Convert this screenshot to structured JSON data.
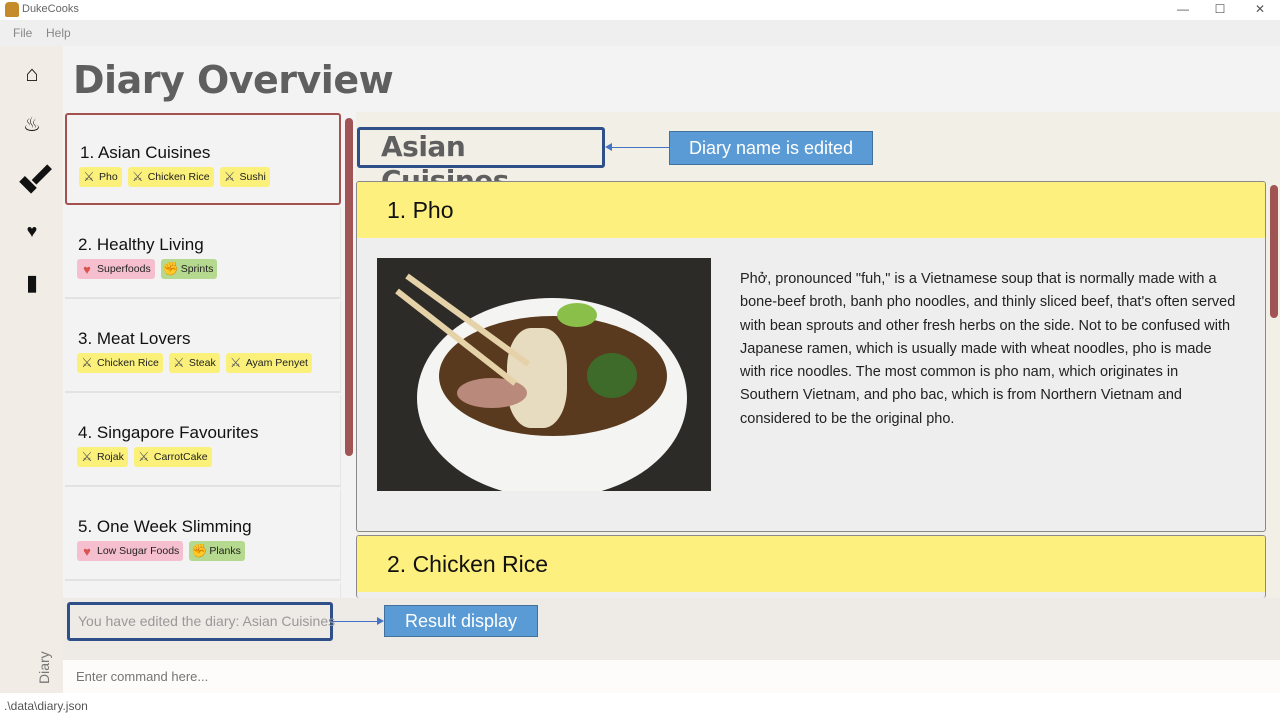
{
  "window": {
    "title": "DukeCooks",
    "minimize_icon": "minimize-icon",
    "maximize_icon": "maximize-icon",
    "close_icon": "close-icon"
  },
  "menu": {
    "file": "File",
    "help": "Help"
  },
  "rail": {
    "items": [
      "home-icon",
      "chef-hat-icon",
      "dumbbell-icon",
      "heartbeat-icon",
      "diary-book-icon"
    ],
    "label": "Diary"
  },
  "page_title": "Diary Overview",
  "diaries": [
    {
      "name": "1.  Asian Cuisines",
      "tags": [
        {
          "type": "food",
          "label": "Pho"
        },
        {
          "type": "food",
          "label": "Chicken Rice"
        },
        {
          "type": "food",
          "label": "Sushi"
        }
      ]
    },
    {
      "name": "2.  Healthy Living",
      "tags": [
        {
          "type": "health",
          "label": "Superfoods"
        },
        {
          "type": "ex",
          "label": "Sprints"
        }
      ]
    },
    {
      "name": "3.  Meat Lovers",
      "tags": [
        {
          "type": "food",
          "label": "Chicken Rice"
        },
        {
          "type": "food",
          "label": "Steak"
        },
        {
          "type": "food",
          "label": "Ayam Penyet"
        }
      ]
    },
    {
      "name": "4.  Singapore Favourites",
      "tags": [
        {
          "type": "food",
          "label": "Rojak"
        },
        {
          "type": "food",
          "label": "CarrotCake"
        }
      ]
    },
    {
      "name": "5.  One Week Slimming",
      "tags": [
        {
          "type": "health",
          "label": "Low Sugar Foods"
        },
        {
          "type": "ex",
          "label": "Planks"
        }
      ]
    }
  ],
  "detail": {
    "diary_name": "Asian Cuisines",
    "pages": [
      {
        "title": "1. Pho",
        "description": "Phở, pronounced \"fuh,\" is a Vietnamese soup that is normally made with a bone-beef broth, banh pho noodles, and thinly sliced beef, that's often served with bean sprouts and other fresh herbs on the side. Not to be confused with Japanese ramen, which is usually made with wheat noodles, pho is made with rice noodles. The most common is pho nam, which originates in Southern Vietnam, and pho bac, which is from Northern Vietnam and considered to be the original pho."
      },
      {
        "title": "2. Chicken Rice"
      }
    ]
  },
  "annotations": {
    "diary_name": "Diary name is edited",
    "result": "Result display"
  },
  "result": "You have edited the diary: Asian Cuisines",
  "command": {
    "placeholder": "Enter command here..."
  },
  "status": ".\\data\\diary.json",
  "colors": {
    "accent": "#a05454",
    "annotation": "#5b9bd5",
    "page_header": "#fdf07f",
    "highlight_border": "#2f4f88"
  }
}
